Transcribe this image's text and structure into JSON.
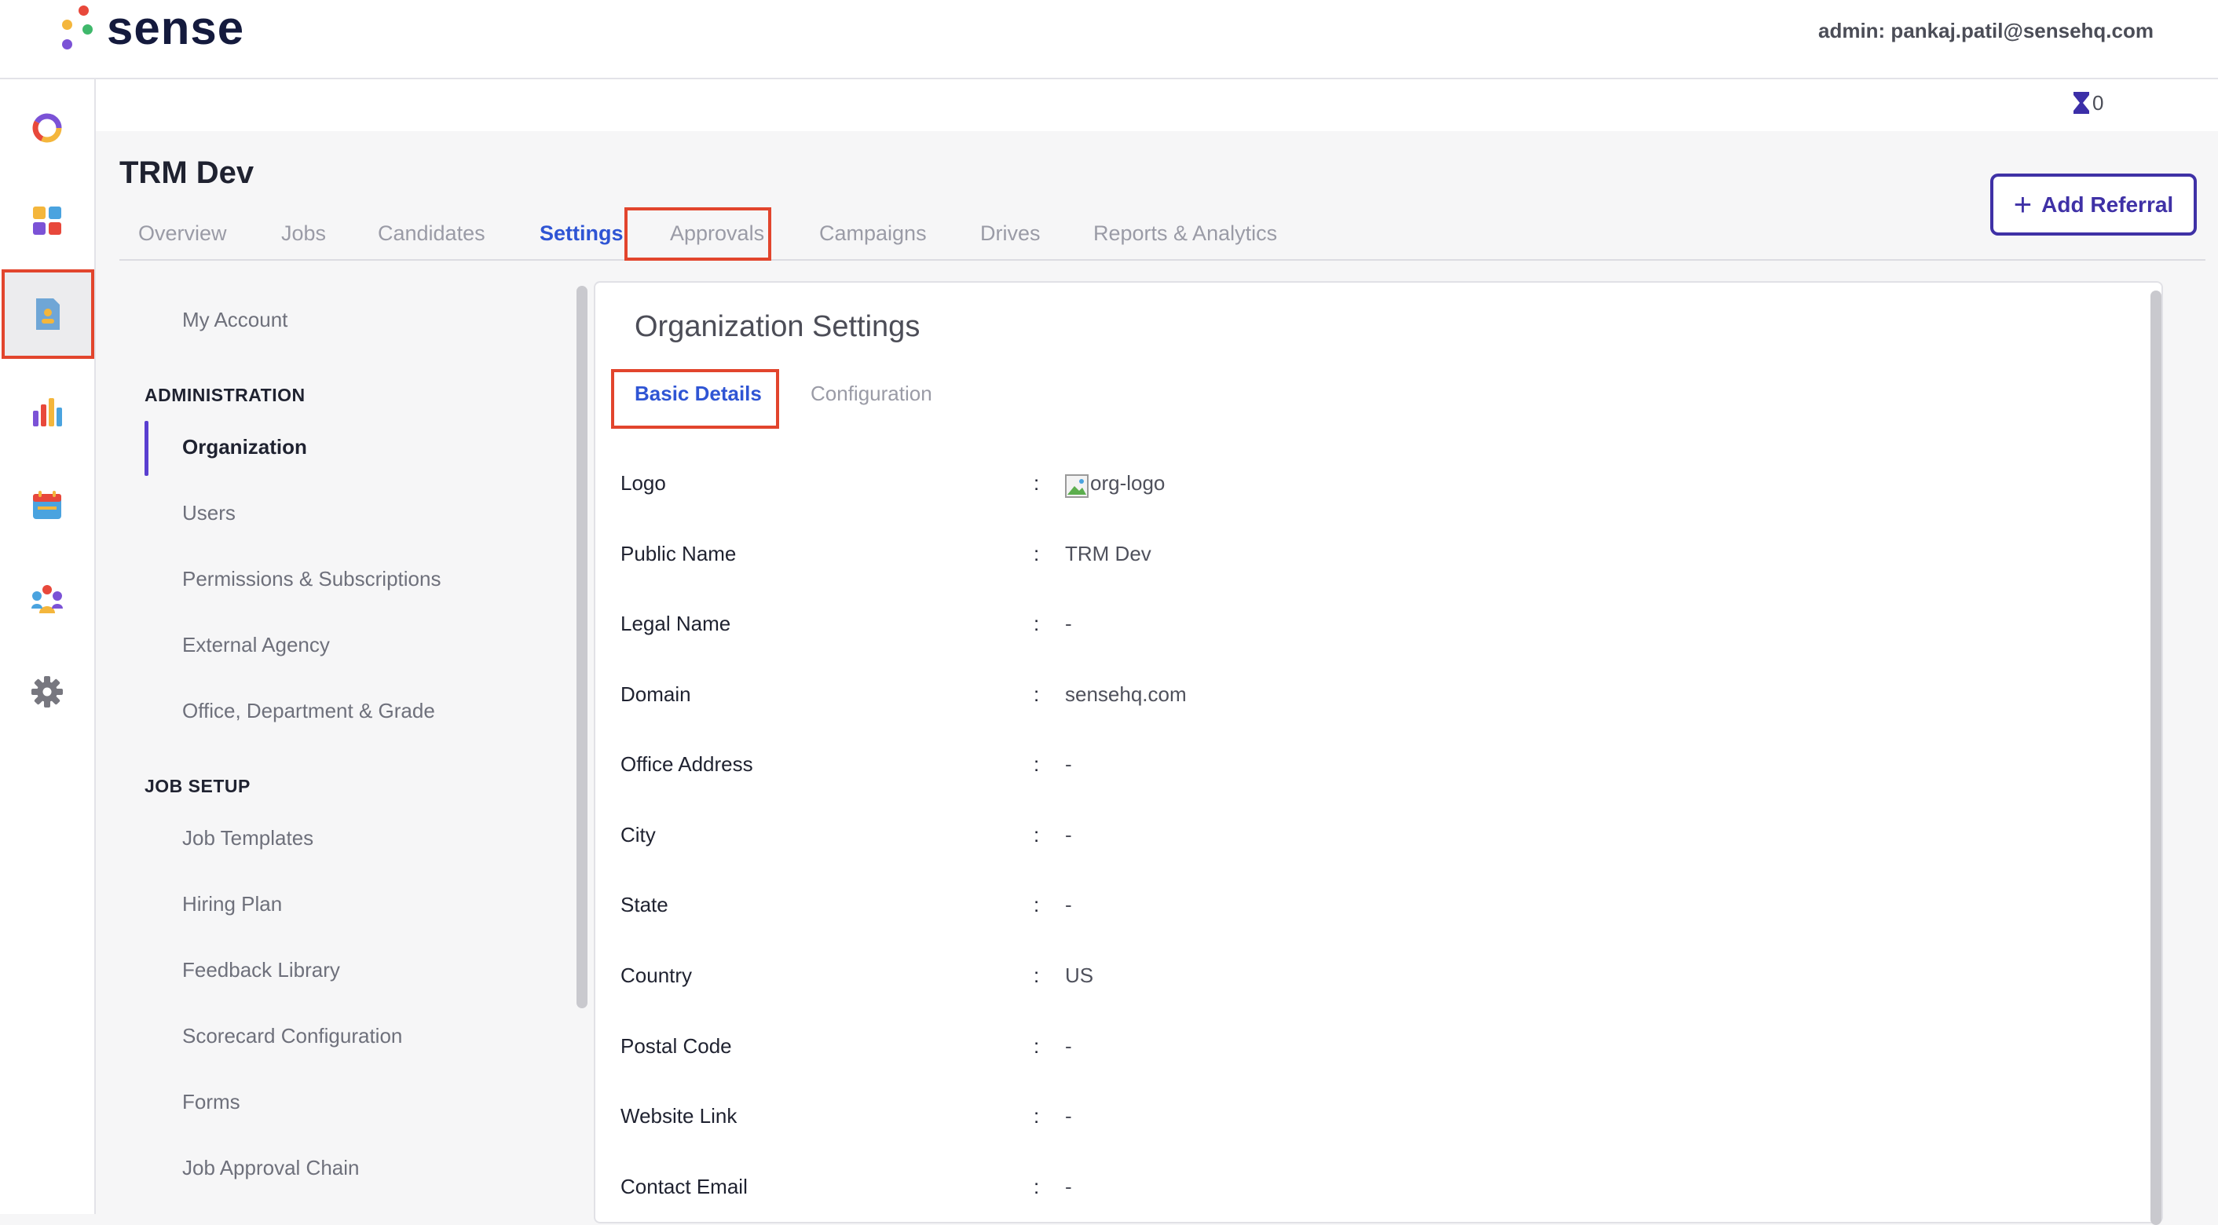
{
  "brand": {
    "name": "sense"
  },
  "header": {
    "admin_label": "admin: pankaj.patil@sensehq.com"
  },
  "utility": {
    "hourglass_count": "0"
  },
  "leftnav": [
    "dashboard-icon",
    "apps-icon",
    "document-icon",
    "analytics-icon",
    "calendar-icon",
    "people-icon",
    "settings-gear-icon"
  ],
  "org": {
    "title": "TRM Dev"
  },
  "tabs": [
    "Overview",
    "Jobs",
    "Candidates",
    "Settings",
    "Approvals",
    "Campaigns",
    "Drives",
    "Reports & Analytics"
  ],
  "add_referral": "Add Referral",
  "settings_nav": {
    "my_account": "My Account",
    "administration_label": "ADMINISTRATION",
    "administration": [
      "Organization",
      "Users",
      "Permissions & Subscriptions",
      "External Agency",
      "Office, Department & Grade"
    ],
    "job_setup_label": "JOB SETUP",
    "job_setup": [
      "Job Templates",
      "Hiring Plan",
      "Feedback Library",
      "Scorecard Configuration",
      "Forms",
      "Job Approval Chain"
    ]
  },
  "panel": {
    "title": "Organization Settings",
    "tabs": [
      "Basic Details",
      "Configuration"
    ],
    "fields": [
      {
        "label": "Logo",
        "value": "org-logo"
      },
      {
        "label": "Public Name",
        "value": "TRM Dev"
      },
      {
        "label": "Legal Name",
        "value": "-"
      },
      {
        "label": "Domain",
        "value": "sensehq.com"
      },
      {
        "label": "Office Address",
        "value": "-"
      },
      {
        "label": "City",
        "value": "-"
      },
      {
        "label": "State",
        "value": "-"
      },
      {
        "label": "Country",
        "value": "US"
      },
      {
        "label": "Postal Code",
        "value": "-"
      },
      {
        "label": "Website Link",
        "value": "-"
      },
      {
        "label": "Contact Email",
        "value": "-"
      }
    ],
    "colon": ":"
  }
}
